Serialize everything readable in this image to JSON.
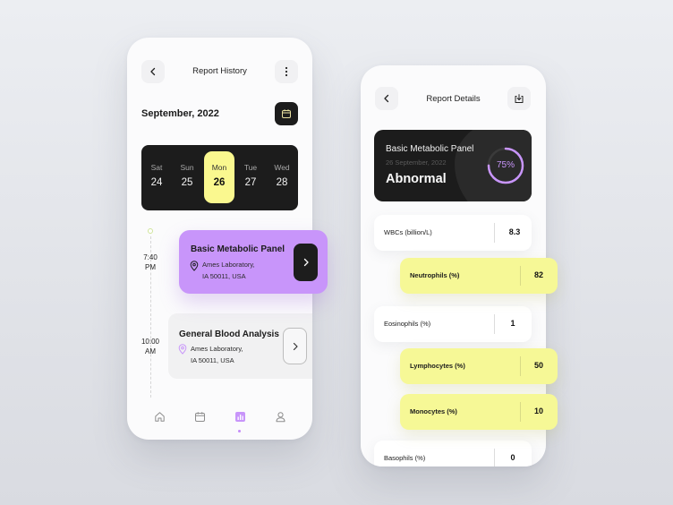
{
  "colors": {
    "accent_purple": "#c895fa",
    "accent_yellow": "#faf88f",
    "dark": "#1c1c1c"
  },
  "left": {
    "header": {
      "back_icon": "chevron-left-icon",
      "title": "Report History",
      "menu_icon": "more-vertical-icon"
    },
    "month": "September, 2022",
    "calendar_icon": "calendar-icon",
    "days": [
      {
        "name": "Sat",
        "date": "24",
        "selected": false
      },
      {
        "name": "Sun",
        "date": "25",
        "selected": false
      },
      {
        "name": "Mon",
        "date": "26",
        "selected": true
      },
      {
        "name": "Tue",
        "date": "27",
        "selected": false
      },
      {
        "name": "Wed",
        "date": "28",
        "selected": false
      }
    ],
    "reports": [
      {
        "time_line1": "7:40",
        "time_line2": "PM",
        "title": "Basic Metabolic Panel",
        "addr_line1": "Ames Laboratory,",
        "addr_line2": "IA 50011, USA"
      },
      {
        "time_line1": "10:00",
        "time_line2": "AM",
        "title": "General Blood Analysis",
        "addr_line1": "Ames Laboratory,",
        "addr_line2": "IA 50011, USA"
      }
    ],
    "nav": [
      "home-icon",
      "calendar-icon",
      "chart-icon",
      "user-icon"
    ],
    "nav_active": "chart-icon"
  },
  "right": {
    "header": {
      "back_icon": "chevron-left-icon",
      "title": "Report Details",
      "download_icon": "download-icon"
    },
    "summary": {
      "title": "Basic Metabolic Panel",
      "date": "26 September, 2022",
      "status": "Abnormal",
      "score_text": "75%",
      "score_fraction": 0.75
    },
    "rows": [
      {
        "label": "WBCs (billion/L)",
        "value": "8.3",
        "highlight": false
      },
      {
        "label": "Neutrophils (%)",
        "value": "82",
        "highlight": true
      },
      {
        "label": "Eosinophils (%)",
        "value": "1",
        "highlight": false
      },
      {
        "label": "Lymphocytes (%)",
        "value": "50",
        "highlight": true
      },
      {
        "label": "Monocytes (%)",
        "value": "10",
        "highlight": true
      },
      {
        "label": "Basophils (%)",
        "value": "0",
        "highlight": false
      }
    ]
  }
}
